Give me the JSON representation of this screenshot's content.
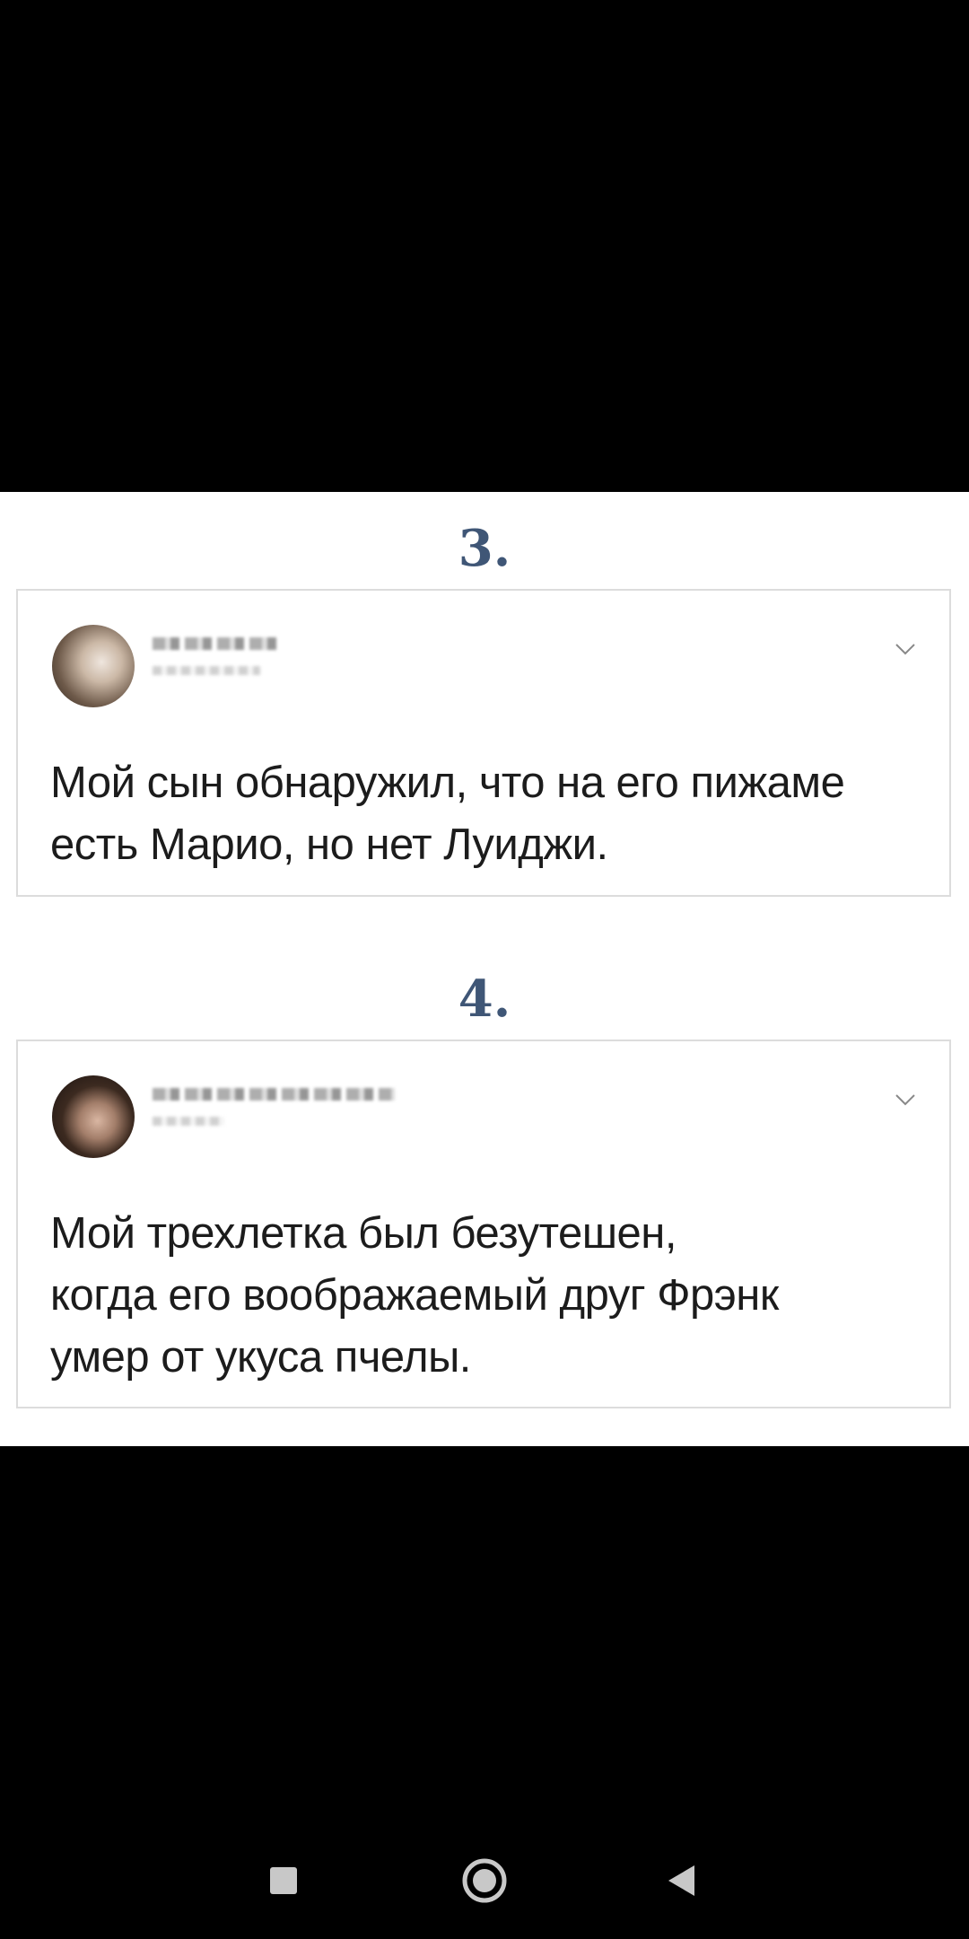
{
  "items": [
    {
      "number": "3.",
      "tweet_text": "Мой сын обнаружил, что на его пижаме\nесть Марио, но нет Луиджи.",
      "menu_icon": "chevron-down-icon"
    },
    {
      "number": "4.",
      "tweet_text": "Мой трехлетка был безутешен,\nкогда его воображаемый друг Фрэнк\nумер от укуса пчелы.",
      "menu_icon": "chevron-down-icon"
    }
  ],
  "navigation_bar": {
    "buttons": [
      "recents-icon",
      "home-icon",
      "back-icon"
    ],
    "icon_color": "#c8c8c8"
  },
  "colors": {
    "number_color": "#3f5676",
    "card_border": "#dcdcdc",
    "background": "#000000"
  }
}
